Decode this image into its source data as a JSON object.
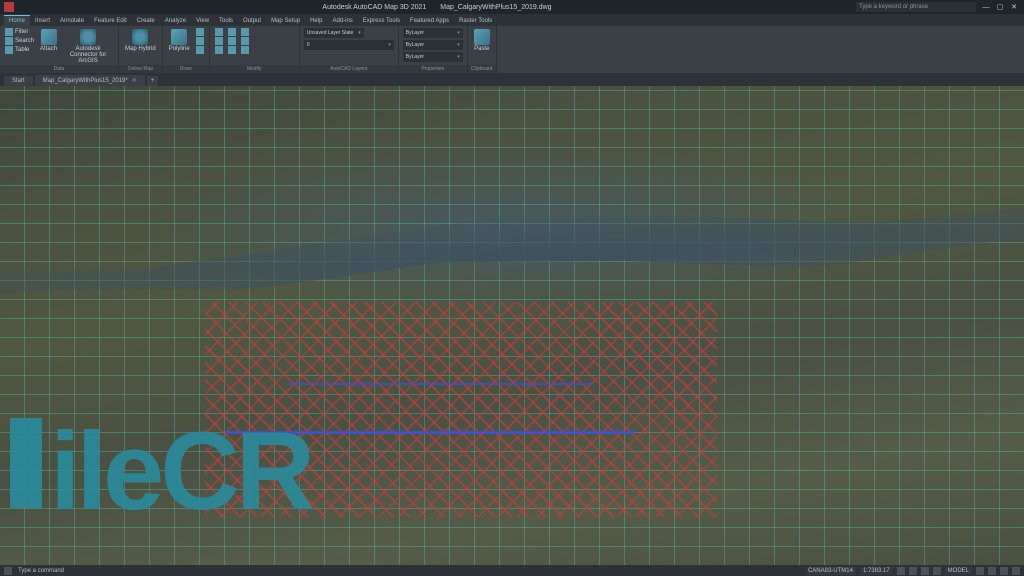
{
  "titlebar": {
    "app_name": "Autodesk AutoCAD Map 3D 2021",
    "document": "Map_CalgaryWithPlus15_2019.dwg",
    "search_placeholder": "Type a keyword or phrase"
  },
  "ribbon_tabs": {
    "items": [
      "Home",
      "Insert",
      "Annotate",
      "Feature Edit",
      "Create",
      "Analyze",
      "View",
      "Tools",
      "Output",
      "Map Setup",
      "Help",
      "Add-ins",
      "Express Tools",
      "Featured Apps",
      "Raster Tools"
    ],
    "active": 0
  },
  "ribbon": {
    "panels": [
      {
        "label": "Data",
        "buttons": [
          {
            "label": "Filter"
          },
          {
            "label": "Search"
          },
          {
            "label": "Table"
          },
          {
            "label": "Attach"
          },
          {
            "label": "Autodesk Connector for ArcGIS"
          }
        ]
      },
      {
        "label": "Online Map",
        "buttons": [
          {
            "label": "Map Hybrid"
          }
        ]
      },
      {
        "label": "Draw",
        "buttons": [
          {
            "label": "Polyline"
          }
        ]
      },
      {
        "label": "Modify",
        "buttons": []
      },
      {
        "label": "AutoCAD Layers",
        "dropdown": "Unsaved Layer State"
      },
      {
        "label": "Properties",
        "dropdown": "ByLayer"
      },
      {
        "label": "Clipboard",
        "buttons": [
          {
            "label": "Paste"
          }
        ]
      }
    ]
  },
  "doc_tabs": {
    "items": [
      "Start",
      "Map_CalgaryWithPlus15_2019*"
    ]
  },
  "statusbar": {
    "coord_sys": "CANA83-UTM14",
    "coords": "1:7383.17",
    "model": "MODEL"
  },
  "watermark": {
    "text": "ileCR"
  }
}
